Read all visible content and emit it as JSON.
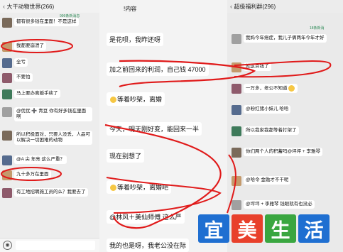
{
  "left": {
    "title": "大干动物世界(266)",
    "forward_note": "999条新消息",
    "messages": [
      {
        "text": "都有很多钱在里面！不是这样"
      },
      {
        "text": "我都要崩溃了"
      },
      {
        "text": "全亏"
      },
      {
        "text": "不要怕"
      },
      {
        "text": "马上要办离婚手续了"
      },
      {
        "text": "@优优 ➕ 青豆 你有好多钱在里面啊"
      },
      {
        "text": "所以积极面对，只要人没丢，人品可以解决一切困难的动物"
      },
      {
        "text": "@A 尖 年亮 这么严重？"
      },
      {
        "text": "九十多万在里面"
      },
      {
        "text": "有工地招聘施工员的么？我要去了"
      }
    ]
  },
  "middle": {
    "top": "!内容",
    "messages": [
      {
        "text": "是花呗，我昨还呀"
      },
      {
        "text": "加之前回来的利润，自己钱 47000"
      },
      {
        "text": "等着吵架，离婚"
      },
      {
        "text": "今天，明天刚好变，能回来一半"
      },
      {
        "text": "现在别想了"
      },
      {
        "text": "等着吵架，离婚吧"
      },
      {
        "text": "@林风＋美仙师傅 这么严"
      },
      {
        "text": "我的也是呀，我老公没在际"
      }
    ]
  },
  "right": {
    "title": "超级福利群(296)",
    "forward_note": "18条新消",
    "messages": [
      {
        "text": "我妈今年癌症，我儿子俩两年今年才好"
      },
      {
        "text": "就这点钱了"
      },
      {
        "text": "一万多，老公不知道"
      },
      {
        "text": "@粉红猪小妹儿 哈哈"
      },
      {
        "text": "所以我家我都等着打架了"
      },
      {
        "text": "你们两个人的积蓄吗@坪坪 + 李雅琴"
      },
      {
        "text": "@哈令 金融才不干呢"
      },
      {
        "text": "@坪坪 + 李雅琴 钱眼就有也没必"
      }
    ]
  },
  "watermark": {
    "chars": [
      "宜",
      "美",
      "生",
      "活"
    ],
    "colors": [
      "#1f6fd1",
      "#e8402b",
      "#3aa640",
      "#1f6fd1"
    ]
  },
  "annotation_color": "#e01a1a"
}
